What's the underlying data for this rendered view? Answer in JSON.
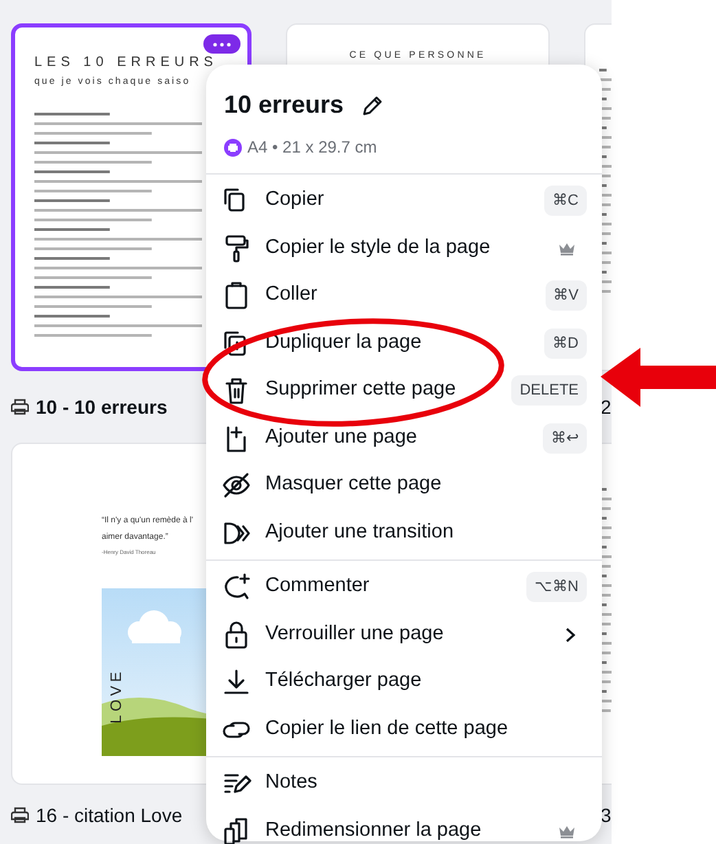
{
  "pages": [
    [
      {
        "kind": "document",
        "selected": true,
        "title": "LES 10 ERREURS",
        "subtitle": "que je vois chaque saiso",
        "label": "10 - 10 erreurs"
      },
      {
        "kind": "document",
        "selected": false,
        "title": "CE QUE PERSONNE"
      },
      {
        "kind": "document",
        "selected": false,
        "label": "2"
      }
    ],
    [
      {
        "kind": "quote",
        "selected": false,
        "quote": "“Il n'y a qu'un remède à l'",
        "quote_2": "aimer davantage.”",
        "author": "-Henry David Thoreau",
        "vertical_word": "LOVE",
        "label": "16 - citation Love"
      },
      {
        "kind": "document",
        "selected": false,
        "label": "3"
      }
    ]
  ],
  "menu": {
    "title": "10 erreurs",
    "format": "A4 • 21 x 29.7 cm",
    "groups": [
      [
        {
          "label": "Copier",
          "shortcut": "⌘C",
          "premium": false,
          "submenu": false
        },
        {
          "label": "Copier le style de la page",
          "premium": true,
          "submenu": false
        },
        {
          "label": "Coller",
          "shortcut": "⌘V",
          "premium": false,
          "submenu": false
        },
        {
          "label": "Dupliquer la page",
          "shortcut": "⌘D",
          "premium": false,
          "submenu": false
        },
        {
          "label": "Supprimer cette page",
          "shortcut": "DELETE",
          "premium": false,
          "submenu": false
        },
        {
          "label": "Ajouter une page",
          "shortcut": "⌘↩",
          "premium": false,
          "submenu": false
        },
        {
          "label": "Masquer cette page",
          "premium": false,
          "submenu": false
        },
        {
          "label": "Ajouter une transition",
          "premium": false,
          "submenu": false
        }
      ],
      [
        {
          "label": "Commenter",
          "shortcut": "⌥⌘N",
          "premium": false,
          "submenu": false
        },
        {
          "label": "Verrouiller une page",
          "premium": false,
          "submenu": true
        },
        {
          "label": "Télécharger page",
          "premium": false,
          "submenu": false
        },
        {
          "label": "Copier le lien de cette page",
          "premium": false,
          "submenu": false
        }
      ],
      [
        {
          "label": "Notes",
          "premium": false,
          "submenu": false
        },
        {
          "label": "Redimensionner la page",
          "premium": true,
          "submenu": false
        }
      ]
    ]
  }
}
